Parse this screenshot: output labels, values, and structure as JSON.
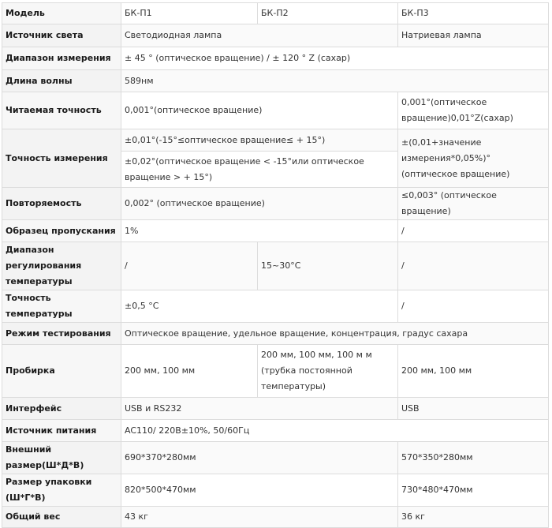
{
  "table": {
    "model_label": "Модель",
    "models": [
      "БК-П1",
      "БК-П2",
      "БК-П3"
    ],
    "rows": {
      "light": {
        "label": "Источник света",
        "p12": "Светодиодная лампа",
        "p3": "Натриевая лампа"
      },
      "range": {
        "label": "Диапазон измерения",
        "all": "± 45 ° (оптическое вращение) / ± 120 ° Z (сахар)"
      },
      "wave": {
        "label": "Длина волны",
        "all": "589нм"
      },
      "read": {
        "label": "Читаемая точность",
        "p12": "0,001°(оптическое вращение)",
        "p3": "0,001°(оптическое вращение)0,01°Z(сахар)"
      },
      "acc": {
        "label": "Точность измерения",
        "p12_a": "±0,01°(-15°≤оптическое вращение≤ + 15°)",
        "p12_b": "±0,02°(оптическое вращение < -15°или оптическое вращение > + 15°)",
        "p3": "±(0,01+значение измерения*0,05%)°(оптическое вращение)"
      },
      "rep": {
        "label": "Повторяемость",
        "p12": "0,002° (оптическое вращение)",
        "p3": "≤0,003° (оптическое вращение)"
      },
      "trans": {
        "label": "Образец пропускания",
        "p12": "1%",
        "p3": "/"
      },
      "temp": {
        "label": "Диапазон регулирования температуры",
        "p1": "/",
        "p2": "15~30°C",
        "p3": "/"
      },
      "tacc": {
        "label": "Точность температуры",
        "p12": "±0,5 °C",
        "p3": "/"
      },
      "mode": {
        "label": "Режим тестирования",
        "all": "Оптическое вращение, удельное вращение, концентрация, градус сахара"
      },
      "tube": {
        "label": "Пробирка",
        "p1": "200 мм, 100 мм",
        "p2": "200 мм, 100 мм, 100 м м (трубка постоянной температуры)",
        "p3": "200 мм, 100 мм"
      },
      "iface": {
        "label": "Интерфейс",
        "p12": "USB и RS232",
        "p3": "USB"
      },
      "power": {
        "label": "Источник питания",
        "all": "AC110/ 220В±10%, 50/60Гц"
      },
      "size": {
        "label": "Внешний размер(Ш*Д*В)",
        "p12": "690*370*280мм",
        "p3": "570*350*280мм"
      },
      "pack": {
        "label": "Размер упаковки (Ш*Г*В)",
        "p12": "820*500*470мм",
        "p3": "730*480*470мм"
      },
      "weight": {
        "label": "Общий вес",
        "p12": "43 кг",
        "p3": "36 кг"
      }
    }
  }
}
